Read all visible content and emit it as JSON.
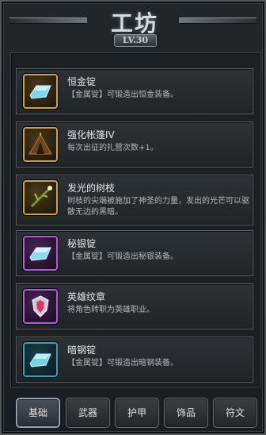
{
  "header": {
    "title": "工坊",
    "level": "LV.30"
  },
  "items": [
    {
      "name": "恒金锭",
      "desc": "【金属锭】可锻造出恒金装备。",
      "icon": "gold-ingot-icon",
      "frame": "gold"
    },
    {
      "name": "强化帐篷IV",
      "desc": "每次出征的扎营次数+1。",
      "icon": "tent-icon",
      "frame": "gold"
    },
    {
      "name": "发光的树枝",
      "desc": "树枝的尖端被施加了神圣的力量，发出的光芒可以驱散无边的黑暗。",
      "icon": "glowing-branch-icon",
      "frame": "gold"
    },
    {
      "name": "秘银锭",
      "desc": "【金属锭】可锻造出秘银装备。",
      "icon": "mithril-ingot-icon",
      "frame": "purple"
    },
    {
      "name": "英雄纹章",
      "desc": "将角色转职为英雄职业。",
      "icon": "hero-crest-icon",
      "frame": "purple"
    },
    {
      "name": "暗钢锭",
      "desc": "【金属锭】可锻造出暗钢装备。",
      "icon": "dark-steel-ingot-icon",
      "frame": "teal"
    }
  ],
  "tabs": [
    {
      "label": "基础",
      "active": true
    },
    {
      "label": "武器",
      "active": false
    },
    {
      "label": "护甲",
      "active": false
    },
    {
      "label": "饰品",
      "active": false
    },
    {
      "label": "符文",
      "active": false
    }
  ],
  "colors": {
    "gold_frame": "#c9a24a",
    "purple_frame": "#b35cd2",
    "teal_frame": "#3d9fb4"
  }
}
